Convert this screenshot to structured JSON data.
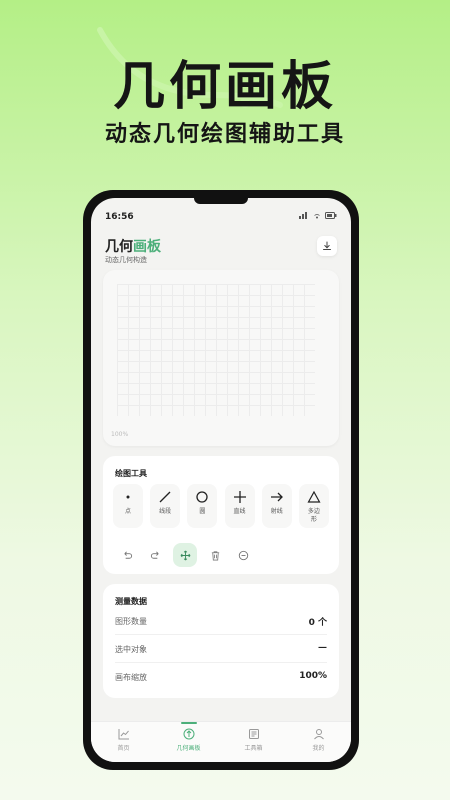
{
  "promo": {
    "title": "几何画板",
    "subtitle": "动态几何绘图辅助工具"
  },
  "status_bar": {
    "time": "16:56"
  },
  "header": {
    "title_plain": "几何",
    "title_highlight": "画板",
    "subtitle": "动态几何构造",
    "download_icon": "download-icon"
  },
  "canvas": {
    "zoom_label": "100%"
  },
  "tools": {
    "title": "绘图工具",
    "items": [
      {
        "label": "点",
        "icon": "point-icon"
      },
      {
        "label": "线段",
        "icon": "segment-icon"
      },
      {
        "label": "圆",
        "icon": "circle-icon"
      },
      {
        "label": "直线",
        "icon": "line-icon"
      },
      {
        "label": "射线",
        "icon": "ray-icon"
      },
      {
        "label": "多边形",
        "icon": "polygon-icon"
      }
    ],
    "actions": [
      {
        "icon": "undo-icon"
      },
      {
        "icon": "redo-icon"
      },
      {
        "icon": "move-icon",
        "active": true
      },
      {
        "icon": "trash-icon"
      },
      {
        "icon": "zoom-out-icon"
      }
    ]
  },
  "measure": {
    "title": "测量数据",
    "rows": [
      {
        "label": "图形数量",
        "value": "0 个"
      },
      {
        "label": "选中对象",
        "value": "—"
      },
      {
        "label": "画布缩放",
        "value": "100%"
      }
    ]
  },
  "nav": {
    "items": [
      {
        "label": "首页",
        "icon": "chart-icon"
      },
      {
        "label": "几何画板",
        "icon": "canvas-icon",
        "active": true
      },
      {
        "label": "工具箱",
        "icon": "toolbox-icon"
      },
      {
        "label": "我的",
        "icon": "user-icon"
      }
    ]
  },
  "colors": {
    "accent": "#4caf7a",
    "background_top": "#b4ef86",
    "background_bottom": "#f4faee"
  }
}
